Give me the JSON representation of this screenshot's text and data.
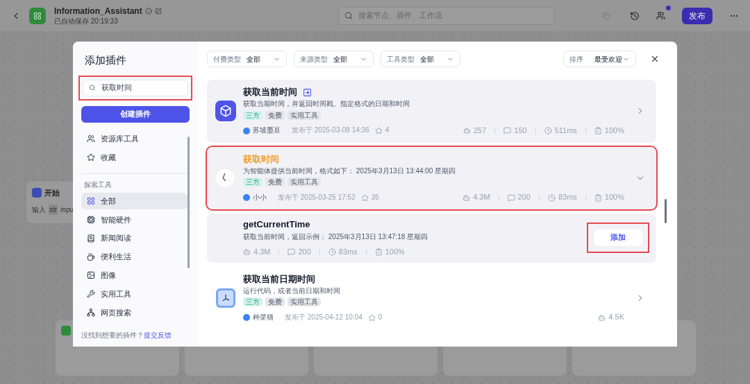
{
  "header": {
    "title": "Information_Assistant",
    "saved": "已自动保存 20:19:33",
    "search": {
      "placeholder": "搜索节点、插件、工作流"
    },
    "publish": "发布"
  },
  "canvas": {
    "start_node": {
      "title": "开始",
      "input_label": "输入",
      "input_type": "str",
      "input_name": "inpu"
    }
  },
  "modal": {
    "title": "添加插件",
    "search": {
      "value": "获取时间"
    },
    "create_button": "创建插件",
    "sidebar": [
      {
        "kind": "item",
        "label": "资源库工具",
        "selected": false
      },
      {
        "kind": "item",
        "label": "收藏",
        "selected": false
      },
      {
        "kind": "heading",
        "label": "探索工具"
      },
      {
        "kind": "item",
        "label": "全部",
        "selected": true
      },
      {
        "kind": "item",
        "label": "智能硬件",
        "selected": false
      },
      {
        "kind": "item",
        "label": "新闻阅读",
        "selected": false
      },
      {
        "kind": "item",
        "label": "便利生活",
        "selected": false
      },
      {
        "kind": "item",
        "label": "图像",
        "selected": false
      },
      {
        "kind": "item",
        "label": "实用工具",
        "selected": false
      },
      {
        "kind": "item",
        "label": "网页搜索",
        "selected": false
      }
    ],
    "footer": {
      "text": "没找到想要的插件？",
      "link": "提交反馈"
    },
    "filters": [
      {
        "label": "付费类型",
        "value": "全部"
      },
      {
        "label": "来源类型",
        "value": "全部"
      },
      {
        "label": "工具类型",
        "value": "全部"
      }
    ],
    "sort": {
      "label": "排序",
      "value": "最受欢迎"
    },
    "results": [
      {
        "kind": "plugin",
        "name": "获取当前时间",
        "highlighted": false,
        "linked": true,
        "marked": false,
        "expanded": false,
        "description": "获取当期时间，并返回时间戳、指定格式的日期和时间",
        "tags": [
          "三方",
          "免费",
          "实用工具"
        ],
        "author": "苏坡墨豆",
        "published": "发布于 2025-03-08 14:36",
        "favorites": "4",
        "stats": [
          {
            "kind": "calls",
            "text": "257"
          },
          {
            "kind": "bots",
            "text": "150"
          },
          {
            "kind": "latency",
            "text": "511ms"
          },
          {
            "kind": "success",
            "text": "100%"
          }
        ]
      },
      {
        "kind": "plugin",
        "name": "获取时间",
        "highlighted": true,
        "linked": false,
        "marked": true,
        "expanded": true,
        "description": "为智能体提供当前时间，格式如下： 2025年3月13日 13:44:00 星期四",
        "tags": [
          "三方",
          "免费",
          "实用工具"
        ],
        "author": "小小",
        "published": "发布于 2025-03-25 17:52",
        "favorites": "35",
        "stats": [
          {
            "kind": "calls",
            "text": "4.3M"
          },
          {
            "kind": "bots",
            "text": "200"
          },
          {
            "kind": "latency",
            "text": "83ms"
          },
          {
            "kind": "success",
            "text": "100%"
          }
        ]
      },
      {
        "kind": "tool",
        "name": "getCurrentTime",
        "marked": true,
        "description": "获取当前时间，返回示例： 2025年3月13日 13:47:18 星期四",
        "add": "添加",
        "stats": [
          {
            "kind": "calls",
            "text": "4.3M"
          },
          {
            "kind": "bots",
            "text": "200"
          },
          {
            "kind": "latency",
            "text": "83ms"
          },
          {
            "kind": "success",
            "text": "100%"
          }
        ]
      },
      {
        "kind": "plugin",
        "name": "获取当前日期时间",
        "highlighted": false,
        "linked": false,
        "marked": false,
        "expanded": false,
        "description": "运行代码，或者当前日期和时间",
        "tags": [
          "三方",
          "免费",
          "实用工具"
        ],
        "author": "种菜猫",
        "published": "发布于 2025-04-12 10:04",
        "favorites": "0",
        "stats": [
          {
            "kind": "calls",
            "text": "4.5K"
          }
        ]
      }
    ]
  }
}
